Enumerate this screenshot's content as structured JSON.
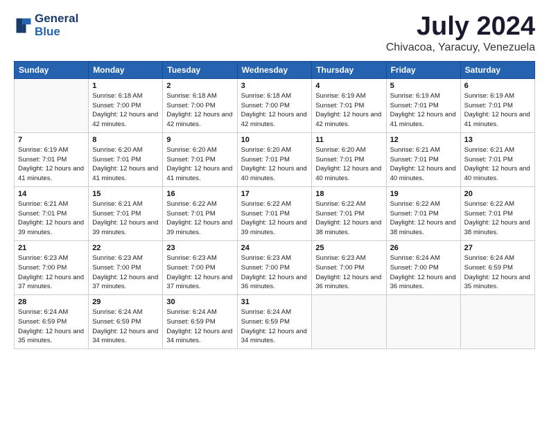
{
  "logo": {
    "line1": "General",
    "line2": "Blue"
  },
  "title": "July 2024",
  "location": "Chivacoa, Yaracuy, Venezuela",
  "weekdays": [
    "Sunday",
    "Monday",
    "Tuesday",
    "Wednesday",
    "Thursday",
    "Friday",
    "Saturday"
  ],
  "weeks": [
    [
      {
        "day": "",
        "sunrise": "",
        "sunset": "",
        "daylight": ""
      },
      {
        "day": "1",
        "sunrise": "6:18 AM",
        "sunset": "7:00 PM",
        "daylight": "12 hours and 42 minutes."
      },
      {
        "day": "2",
        "sunrise": "6:18 AM",
        "sunset": "7:00 PM",
        "daylight": "12 hours and 42 minutes."
      },
      {
        "day": "3",
        "sunrise": "6:18 AM",
        "sunset": "7:00 PM",
        "daylight": "12 hours and 42 minutes."
      },
      {
        "day": "4",
        "sunrise": "6:19 AM",
        "sunset": "7:01 PM",
        "daylight": "12 hours and 42 minutes."
      },
      {
        "day": "5",
        "sunrise": "6:19 AM",
        "sunset": "7:01 PM",
        "daylight": "12 hours and 41 minutes."
      },
      {
        "day": "6",
        "sunrise": "6:19 AM",
        "sunset": "7:01 PM",
        "daylight": "12 hours and 41 minutes."
      }
    ],
    [
      {
        "day": "7",
        "sunrise": "6:19 AM",
        "sunset": "7:01 PM",
        "daylight": "12 hours and 41 minutes."
      },
      {
        "day": "8",
        "sunrise": "6:20 AM",
        "sunset": "7:01 PM",
        "daylight": "12 hours and 41 minutes."
      },
      {
        "day": "9",
        "sunrise": "6:20 AM",
        "sunset": "7:01 PM",
        "daylight": "12 hours and 41 minutes."
      },
      {
        "day": "10",
        "sunrise": "6:20 AM",
        "sunset": "7:01 PM",
        "daylight": "12 hours and 40 minutes."
      },
      {
        "day": "11",
        "sunrise": "6:20 AM",
        "sunset": "7:01 PM",
        "daylight": "12 hours and 40 minutes."
      },
      {
        "day": "12",
        "sunrise": "6:21 AM",
        "sunset": "7:01 PM",
        "daylight": "12 hours and 40 minutes."
      },
      {
        "day": "13",
        "sunrise": "6:21 AM",
        "sunset": "7:01 PM",
        "daylight": "12 hours and 40 minutes."
      }
    ],
    [
      {
        "day": "14",
        "sunrise": "6:21 AM",
        "sunset": "7:01 PM",
        "daylight": "12 hours and 39 minutes."
      },
      {
        "day": "15",
        "sunrise": "6:21 AM",
        "sunset": "7:01 PM",
        "daylight": "12 hours and 39 minutes."
      },
      {
        "day": "16",
        "sunrise": "6:22 AM",
        "sunset": "7:01 PM",
        "daylight": "12 hours and 39 minutes."
      },
      {
        "day": "17",
        "sunrise": "6:22 AM",
        "sunset": "7:01 PM",
        "daylight": "12 hours and 39 minutes."
      },
      {
        "day": "18",
        "sunrise": "6:22 AM",
        "sunset": "7:01 PM",
        "daylight": "12 hours and 38 minutes."
      },
      {
        "day": "19",
        "sunrise": "6:22 AM",
        "sunset": "7:01 PM",
        "daylight": "12 hours and 38 minutes."
      },
      {
        "day": "20",
        "sunrise": "6:22 AM",
        "sunset": "7:01 PM",
        "daylight": "12 hours and 38 minutes."
      }
    ],
    [
      {
        "day": "21",
        "sunrise": "6:23 AM",
        "sunset": "7:00 PM",
        "daylight": "12 hours and 37 minutes."
      },
      {
        "day": "22",
        "sunrise": "6:23 AM",
        "sunset": "7:00 PM",
        "daylight": "12 hours and 37 minutes."
      },
      {
        "day": "23",
        "sunrise": "6:23 AM",
        "sunset": "7:00 PM",
        "daylight": "12 hours and 37 minutes."
      },
      {
        "day": "24",
        "sunrise": "6:23 AM",
        "sunset": "7:00 PM",
        "daylight": "12 hours and 36 minutes."
      },
      {
        "day": "25",
        "sunrise": "6:23 AM",
        "sunset": "7:00 PM",
        "daylight": "12 hours and 36 minutes."
      },
      {
        "day": "26",
        "sunrise": "6:24 AM",
        "sunset": "7:00 PM",
        "daylight": "12 hours and 36 minutes."
      },
      {
        "day": "27",
        "sunrise": "6:24 AM",
        "sunset": "6:59 PM",
        "daylight": "12 hours and 35 minutes."
      }
    ],
    [
      {
        "day": "28",
        "sunrise": "6:24 AM",
        "sunset": "6:59 PM",
        "daylight": "12 hours and 35 minutes."
      },
      {
        "day": "29",
        "sunrise": "6:24 AM",
        "sunset": "6:59 PM",
        "daylight": "12 hours and 34 minutes."
      },
      {
        "day": "30",
        "sunrise": "6:24 AM",
        "sunset": "6:59 PM",
        "daylight": "12 hours and 34 minutes."
      },
      {
        "day": "31",
        "sunrise": "6:24 AM",
        "sunset": "6:59 PM",
        "daylight": "12 hours and 34 minutes."
      },
      {
        "day": "",
        "sunrise": "",
        "sunset": "",
        "daylight": ""
      },
      {
        "day": "",
        "sunrise": "",
        "sunset": "",
        "daylight": ""
      },
      {
        "day": "",
        "sunrise": "",
        "sunset": "",
        "daylight": ""
      }
    ]
  ]
}
